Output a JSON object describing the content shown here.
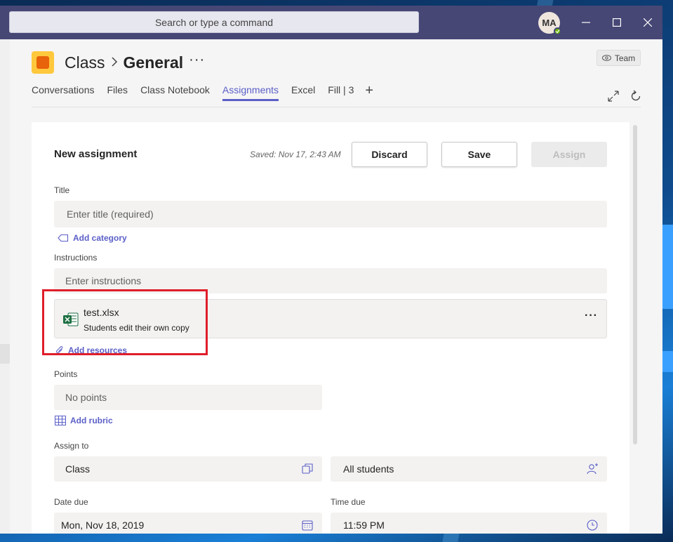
{
  "titlebar": {
    "search_placeholder": "Search or type a command",
    "avatar_initials": "MA",
    "presence_color": "#6bb700"
  },
  "header": {
    "team": "Class",
    "channel": "General",
    "more": "···",
    "team_button": "Team",
    "tabs": [
      {
        "label": "Conversations",
        "active": false
      },
      {
        "label": "Files",
        "active": false
      },
      {
        "label": "Class Notebook",
        "active": false
      },
      {
        "label": "Assignments",
        "active": true
      },
      {
        "label": "Excel",
        "active": false
      },
      {
        "label": "Fill | 3",
        "active": false
      }
    ],
    "add_tab": "+",
    "accent_color": "#5b5fc7"
  },
  "assignment": {
    "heading": "New assignment",
    "saved_text": "Saved: Nov 17, 2:43 AM",
    "discard_label": "Discard",
    "save_label": "Save",
    "assign_label": "Assign",
    "title_label": "Title",
    "title_placeholder": "Enter title (required)",
    "add_category": "Add category",
    "instructions_label": "Instructions",
    "instructions_placeholder": "Enter instructions",
    "attachment": {
      "filename": "test.xlsx",
      "subtitle": "Students edit their own copy",
      "more": "···"
    },
    "add_resources": "Add resources",
    "points_label": "Points",
    "points_value": "No points",
    "add_rubric": "Add rubric",
    "assign_to_label": "Assign to",
    "assign_class": "Class",
    "assign_students": "All students",
    "date_due_label": "Date due",
    "date_due": "Mon, Nov 18, 2019",
    "time_due_label": "Time due",
    "time_due": "11:59 PM"
  }
}
